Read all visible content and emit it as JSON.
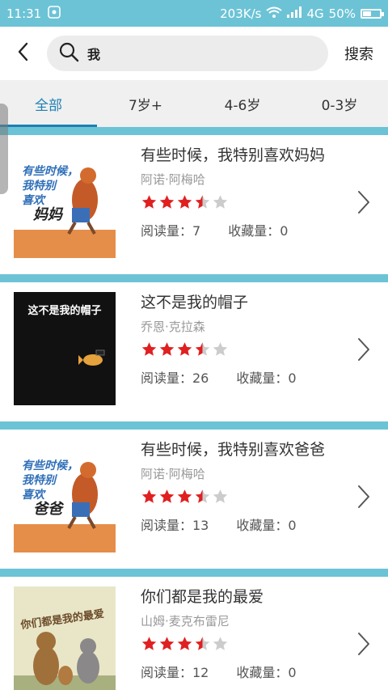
{
  "status": {
    "time": "11:31",
    "network_speed": "203K/s",
    "network_type": "4G",
    "battery_percent": "50%",
    "battery_level": 0.5
  },
  "search": {
    "query": "我",
    "button_label": "搜索"
  },
  "tabs": [
    {
      "label": "全部",
      "active": true
    },
    {
      "label": "7岁+",
      "active": false
    },
    {
      "label": "4-6岁",
      "active": false
    },
    {
      "label": "0-3岁",
      "active": false
    }
  ],
  "books": [
    {
      "title": "有些时候，我特别喜欢妈妈",
      "author": "阿诺·阿梅哈",
      "rating": 3.5,
      "reads_label": "阅读量：7",
      "favorites_label": "收藏量：0",
      "cover": {
        "lines": [
          "有些时候，",
          "我特别",
          "喜欢",
          "妈妈"
        ],
        "bg": "#ffffff",
        "accent": "#e07a2a",
        "text_color": "#2f6fb8"
      }
    },
    {
      "title": "这不是我的帽子",
      "author": "乔恩·克拉森",
      "rating": 3.5,
      "reads_label": "阅读量：26",
      "favorites_label": "收藏量：0",
      "cover": {
        "lines": [
          "这不是我的帽子"
        ],
        "bg": "#111111",
        "accent": "#e6a23c",
        "text_color": "#ffffff"
      }
    },
    {
      "title": "有些时候，我特别喜欢爸爸",
      "author": "阿诺·阿梅哈",
      "rating": 3.5,
      "reads_label": "阅读量：13",
      "favorites_label": "收藏量：0",
      "cover": {
        "lines": [
          "有些时候，",
          "我特别",
          "喜欢",
          "爸爸"
        ],
        "bg": "#ffffff",
        "accent": "#e07a2a",
        "text_color": "#2f6fb8"
      }
    },
    {
      "title": "你们都是我的最爱",
      "author": "山姆·麦克布雷尼",
      "rating": 3.5,
      "reads_label": "阅读量：12",
      "favorites_label": "收藏量：0",
      "cover": {
        "lines": [
          "你们都是我的最爱"
        ],
        "bg": "#e9e6c8",
        "accent": "#8a5a3a",
        "text_color": "#6b4b2a"
      }
    }
  ],
  "colors": {
    "accent_blue": "#1d7fb3",
    "teal": "#6cc3d6",
    "star_filled": "#e02020",
    "star_empty": "#cccccc"
  }
}
